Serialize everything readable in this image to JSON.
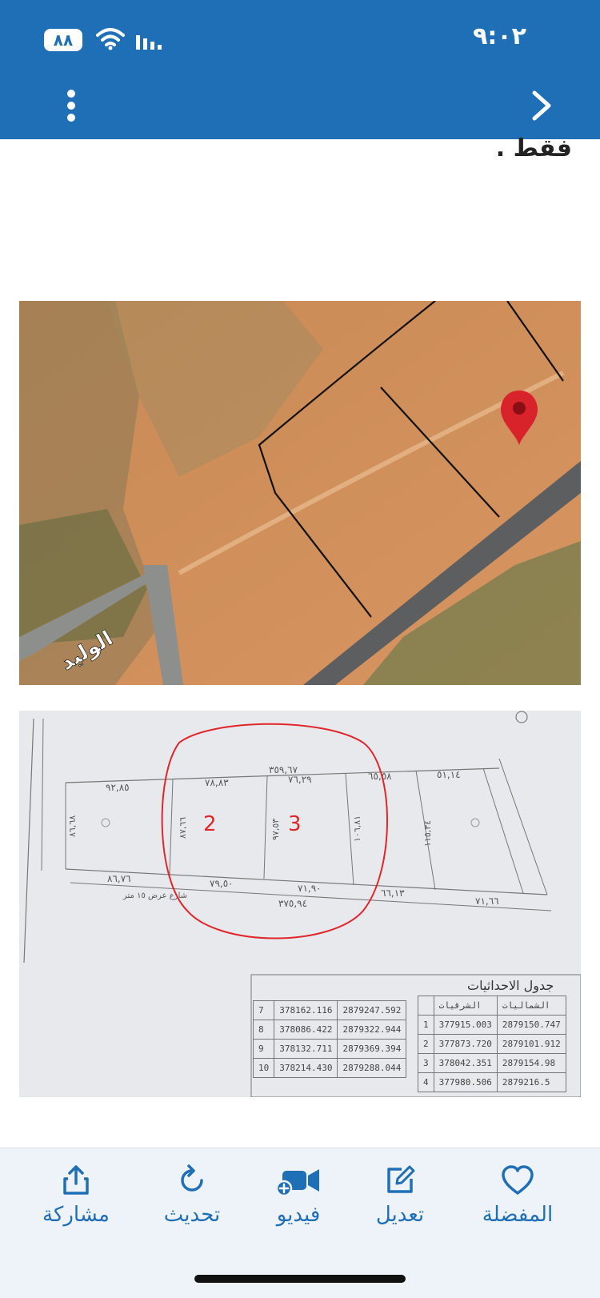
{
  "status_bar": {
    "time": "٩:٠٢",
    "battery": "٨٨"
  },
  "article": {
    "text": "فقط ."
  },
  "map_image": {
    "street_label": "الوليد",
    "pin_color": "#d8232a"
  },
  "plan_image": {
    "plot_numbers": [
      "2",
      "3"
    ],
    "measurements": {
      "top_total": "٣٥٩,٦٧",
      "seg1": "٩٢,٨٥",
      "seg2": "٧٨,٨٣",
      "seg3": "٧٦,٢٩",
      "seg4": "٦٥,٥٨",
      "seg5": "٥١,١٤",
      "left_side": "٨٦,٦٨",
      "side2": "٨٧,٦٦",
      "side3": "٩٧,٥٣",
      "side4": "١٠٦,٨١",
      "side5": "١١٥,٣٤",
      "bottom1": "٨٦,٧٦",
      "bottom2": "٧٩,٥٠",
      "bottom3": "٧١,٩٠",
      "bottom4": "٦٦,١٣",
      "bottom5": "٧١,٦٦",
      "bottom_total": "٣٧٥,٩٤",
      "street_note": "شارع عرض ١٥ متر"
    },
    "coord_table_title": "جدول الاحداثيات",
    "coord_headers": [
      "الشرقيات",
      "الشماليات"
    ],
    "coord_rows_right": [
      {
        "n": "1",
        "e": "377915.003",
        "north": "2879150.747"
      },
      {
        "n": "2",
        "e": "377873.720",
        "north": "2879101.912"
      },
      {
        "n": "3",
        "e": "378042.351",
        "north": "2879154.98"
      },
      {
        "n": "4",
        "e": "377980.506",
        "north": "2879216.5"
      }
    ],
    "coord_rows_left": [
      {
        "n": "7",
        "e": "378162.116",
        "north": "2879247.592"
      },
      {
        "n": "8",
        "e": "378086.422",
        "north": "2879322.944"
      },
      {
        "n": "9",
        "e": "378132.711",
        "north": "2879369.394"
      },
      {
        "n": "10",
        "e": "378214.430",
        "north": "2879288.044"
      }
    ]
  },
  "bottom_bar": {
    "tabs": [
      {
        "label": "مشاركة",
        "icon": "share-icon"
      },
      {
        "label": "تحديث",
        "icon": "refresh-icon"
      },
      {
        "label": "فيديو",
        "icon": "video-icon"
      },
      {
        "label": "تعديل",
        "icon": "edit-icon"
      },
      {
        "label": "المفضلة",
        "icon": "heart-icon"
      }
    ]
  },
  "colors": {
    "header": "#1f6fb7",
    "accent": "#1f6fb7",
    "plan_circle": "#e0262b"
  }
}
